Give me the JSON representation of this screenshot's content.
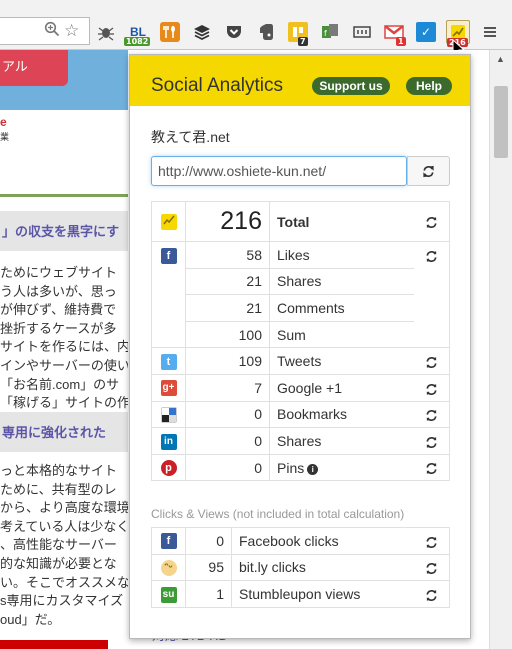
{
  "browser": {
    "icons": [
      "search-icon",
      "bookmark-star-icon",
      "bug-icon",
      "bl-icon",
      "fork-knife-icon",
      "buffer-stack-icon",
      "pocket-icon",
      "evernote-icon",
      "kanban-icon",
      "ff-icon",
      "read-icon",
      "gmail-icon",
      "check-icon",
      "social-analytics-icon",
      "menu-icon"
    ],
    "bl_badge": "1082",
    "kanban_badge": "7",
    "gmail_badge": "1",
    "social_badge": "216"
  },
  "background_page": {
    "banner_text": "アル",
    "logo_text": "e",
    "logo_sub": "業",
    "heading1": "」の収支を黒字にす",
    "paragraph1": [
      "ためにウェブサイト",
      "う人は多いが、思っ",
      "が伸びず、維持費で",
      "挫折するケースが多",
      "サイトを作るには、内",
      "インやサーバーの使い",
      "「お名前.com」のサ",
      "「稼げる」サイトの作"
    ],
    "heading2": "専用に強化された",
    "paragraph2": [
      "っと本格的なサイト",
      "ために、共有型のレ",
      "から、より高度な環境",
      "考えている人は少なく",
      "、高性能なサーバー",
      "的な知識が必要とな",
      "い。そこでオススメな",
      "s専用にカスタマイズ",
      "oud」だ。"
    ],
    "under_text": "対応  2TB HD-"
  },
  "popup": {
    "title": "Social Analytics",
    "support_label": "Support us",
    "help_label": "Help",
    "site_name": "教えて君.net",
    "url_value": "http://www.oshiete-kun.net/",
    "total": {
      "value": "216",
      "label": "Total"
    },
    "facebook": [
      {
        "value": "58",
        "label": "Likes"
      },
      {
        "value": "21",
        "label": "Shares"
      },
      {
        "value": "21",
        "label": "Comments"
      },
      {
        "value": "100",
        "label": "Sum"
      }
    ],
    "networks": [
      {
        "icon": "twitter-icon",
        "value": "109",
        "label": "Tweets"
      },
      {
        "icon": "google-plus-icon",
        "value": "7",
        "label": "Google +1"
      },
      {
        "icon": "delicious-icon",
        "value": "0",
        "label": "Bookmarks"
      },
      {
        "icon": "linkedin-icon",
        "value": "0",
        "label": "Shares"
      },
      {
        "icon": "pinterest-icon",
        "value": "0",
        "label": "Pins"
      }
    ],
    "clicks_label": "Clicks & Views (not included in total calculation)",
    "clicks": [
      {
        "icon": "facebook-icon",
        "value": "0",
        "label": "Facebook clicks"
      },
      {
        "icon": "bitly-icon",
        "value": "95",
        "label": "bit.ly clicks"
      },
      {
        "icon": "stumbleupon-icon",
        "value": "1",
        "label": "Stumbleupon views"
      }
    ]
  },
  "colors": {
    "header_yellow": "#f5d800",
    "button_green": "#3c6a2c",
    "facebook": "#3b5998",
    "twitter": "#55acee",
    "google": "#dd4b39",
    "linkedin": "#0077b5",
    "pinterest": "#cb2027",
    "stumbleupon": "#3d9b35"
  }
}
